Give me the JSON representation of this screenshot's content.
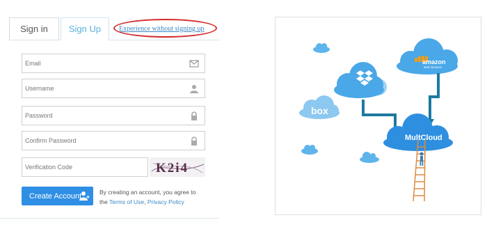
{
  "tabs": {
    "signin": "Sign in",
    "signup": "Sign Up"
  },
  "experience_link": "Experience without signing up",
  "form": {
    "email_placeholder": "Email",
    "username_placeholder": "Username",
    "password_placeholder": "Password",
    "confirm_placeholder": "Confirm Password",
    "verification_placeholder": "Verification Code",
    "captcha_text": "K2i4",
    "create_button": "Create Account",
    "terms_line1": "By creating an account, you agree to",
    "terms_prefix": "the",
    "terms_link": "Terms of Use",
    "terms_sep": ",",
    "privacy_link": "Privacy Policy"
  },
  "illustration": {
    "box_label": "box",
    "amazon_label": "amazon",
    "amazon_sub": "web services",
    "multcloud_label": "MultCloud"
  },
  "colors": {
    "accent": "#2f8fe4",
    "cloud": "#4aa8e8",
    "arrow": "#1b7aa0",
    "link": "#3d88c4",
    "highlight_oval": "#d32a2a"
  },
  "icons": {
    "email": "envelope-icon",
    "username": "user-icon",
    "password": "lock-icon",
    "confirm": "lock-icon",
    "create": "add-user-icon",
    "dropbox": "dropbox-icon"
  }
}
